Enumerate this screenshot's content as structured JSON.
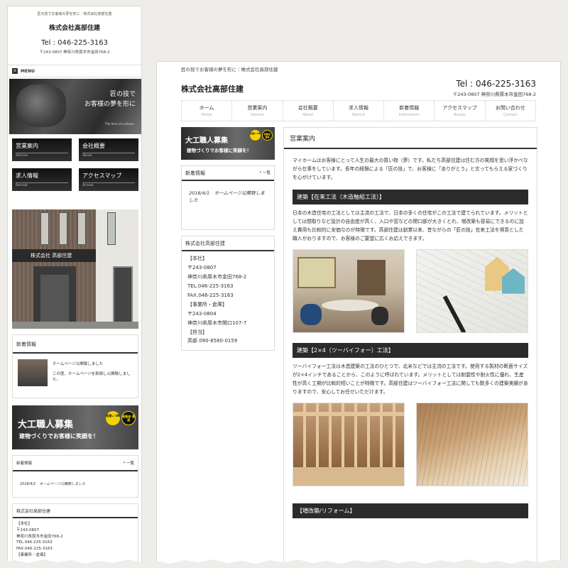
{
  "site": {
    "tagline": "匠の技でお客様の夢を形に｜株式会社高部住建",
    "company": "株式会社高部住建",
    "tel": "Tel : 046-225-3163",
    "address": "〒243-0807 神奈川県厚木市金田768-2"
  },
  "mobile": {
    "menu_label": "MENU",
    "hero_line1": "匠の技で",
    "hero_line2": "お客様の夢を形に",
    "hero_sub": "The form of a dream",
    "nav": [
      {
        "jp": "営業案内",
        "en": "Service"
      },
      {
        "jp": "会社概要",
        "en": "About"
      },
      {
        "jp": "求人情報",
        "en": "Recruit"
      },
      {
        "jp": "アクセスマップ",
        "en": "Access"
      }
    ],
    "building_sign": "株式会社 高部住建",
    "news_title": "新着情報",
    "news_item_title": "ホームページ公開致しました",
    "news_item_body": "この度、ホームページを新設し公開致しました。",
    "recruit_title": "大工職人募集",
    "recruit_sub": "建物づくりでお客様に笑顔を！",
    "badge1": "見習い OK",
    "badge2": "経験者 優遇",
    "news2_title": "新着情報",
    "news2_more": "* 一覧",
    "news2_item": "2018/4/1　ホームページ公開致しました",
    "company_box_title": "株式会社高部住建",
    "company_lines": [
      "【本社】",
      "〒243-0807",
      "神奈川県厚木市金田768-2",
      "TEL.046-225-3163",
      "FAX.046-225-3163",
      "【事業所・倉庫】"
    ]
  },
  "desktop": {
    "nav": [
      {
        "jp": "ホーム",
        "en": "Home"
      },
      {
        "jp": "営業案内",
        "en": "Service"
      },
      {
        "jp": "会社概要",
        "en": "About"
      },
      {
        "jp": "求人情報",
        "en": "Recruit"
      },
      {
        "jp": "新着情報",
        "en": "Information"
      },
      {
        "jp": "アクセスマップ",
        "en": "Access"
      },
      {
        "jp": "お問い合わせ",
        "en": "Contact"
      }
    ],
    "recruit_title": "大工職人募集",
    "recruit_sub": "建物づくりでお客様に笑顔を！",
    "badge1": "見習い OK",
    "badge2": "経験者 優遇",
    "news_title": "新着情報",
    "news_more": "* 一覧",
    "news_item": "2018/4/1　ホームページ公開致しました",
    "company_title": "株式会社高部住建",
    "company_lines": [
      "【本社】",
      "〒243-0807",
      "神奈川県厚木市金田768-2",
      "TEL.046-225-3163",
      "FAX.046-225-3163",
      "【事業所・倉庫】",
      "〒243-0804",
      "神奈川県厚木市関口107-7",
      "【担当】",
      "高部 090-8580-0159"
    ],
    "main_title": "営業案内",
    "intro": "マイホームはお客様にとって人生の最大の買い物（夢）です。私たち高部住建は住む方の笑顔を思い浮かべながら仕事をしています。長年の経験による「匠の技」で、お客様に「ありがとう」と言ってもらえる家づくりを心がけています。",
    "section1_title": "建築【在来工法（木造軸組工法）】",
    "section1_text": "日本の木造住宅の工法としては主流の工法で、日本の多くの住宅がこの工法で建てられています。メリットとしては間取りなど設計の自由度が高く、入口や窓などの開口部が大きくとれ、増改築も容易にできるのに加え費用も比較的に安価なのが特徴です。高部住建は創業以来、昔ながらの「匠の技」在来工法を得意とした職人がおりますので、お客様のご要望に広くお応えできます。",
    "section2_title": "建築【2×4（ツーバイフォー）工法】",
    "section2_text": "ツーバイフォー工法は木造建築の工法のひとつで、北米などでは主流の工法です。使用する製材の断面サイズが2×4インチであることから、このように呼ばれています。メリットとしては耐震性や耐火性に優れ、生産性が高く工期が比較的短いことが特徴です。高部住建はツーバイフォー工法に関しても数多くの建築実績がありますので、安心してお任せいただけます。",
    "section3_title": "【増改築/リフォーム】"
  }
}
